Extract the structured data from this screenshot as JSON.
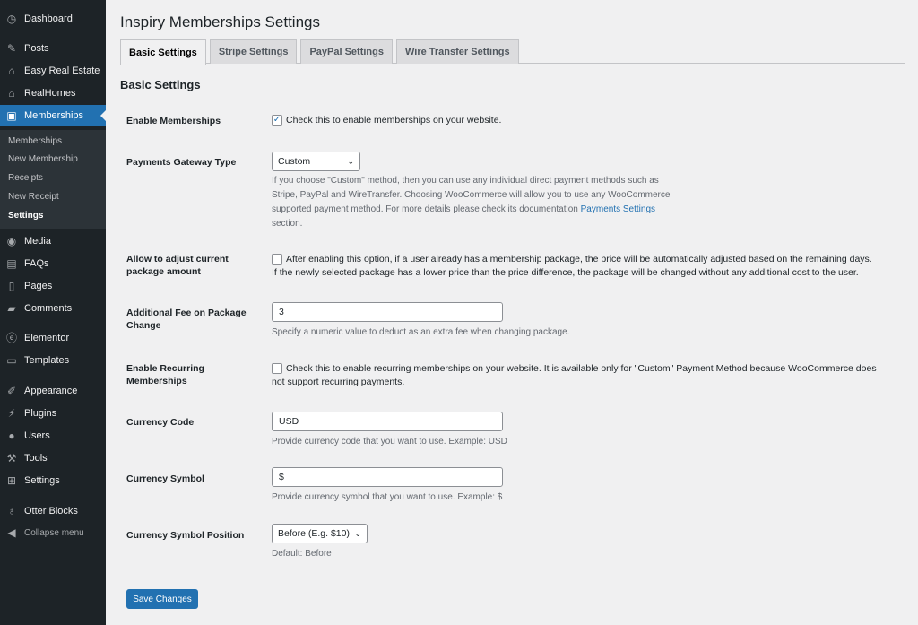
{
  "sidebar": {
    "items": [
      {
        "label": "Dashboard",
        "icon": "dashboard-icon"
      },
      {
        "label": "Posts",
        "icon": "pin-icon"
      },
      {
        "label": "Easy Real Estate",
        "icon": "house-icon"
      },
      {
        "label": "RealHomes",
        "icon": "house-icon"
      },
      {
        "label": "Memberships",
        "icon": "id-card-icon"
      },
      {
        "label": "Media",
        "icon": "media-icon"
      },
      {
        "label": "FAQs",
        "icon": "chat-icon"
      },
      {
        "label": "Pages",
        "icon": "page-icon"
      },
      {
        "label": "Comments",
        "icon": "comment-icon"
      },
      {
        "label": "Elementor",
        "icon": "elementor-icon"
      },
      {
        "label": "Templates",
        "icon": "folder-icon"
      },
      {
        "label": "Appearance",
        "icon": "brush-icon"
      },
      {
        "label": "Plugins",
        "icon": "plug-icon"
      },
      {
        "label": "Users",
        "icon": "user-icon"
      },
      {
        "label": "Tools",
        "icon": "wrench-icon"
      },
      {
        "label": "Settings",
        "icon": "settings-icon"
      },
      {
        "label": "Otter Blocks",
        "icon": "otter-icon"
      }
    ],
    "submenu": [
      "Memberships",
      "New Membership",
      "Receipts",
      "New Receipt",
      "Settings"
    ],
    "collapse": "Collapse menu"
  },
  "page": {
    "title": "Inspiry Memberships Settings",
    "tabs": [
      "Basic Settings",
      "Stripe Settings",
      "PayPal Settings",
      "Wire Transfer Settings"
    ],
    "section_title": "Basic Settings"
  },
  "fields": {
    "enable": {
      "label": "Enable Memberships",
      "checked": true,
      "text": "Check this to enable memberships on your website."
    },
    "gateway": {
      "label": "Payments Gateway Type",
      "value": "Custom",
      "desc_1": "If you choose \"Custom\" method, then you can use any individual direct payment methods such as",
      "desc_2": "Stripe, PayPal and WireTransfer. Choosing WooCommerce will allow you to use any WooCommerce",
      "desc_3": "supported payment method. For more details please check its documentation",
      "desc_link": "Payments Settings",
      "desc_4": "section."
    },
    "adjust": {
      "label_1": "Allow to adjust current",
      "label_2": "package amount",
      "checked": false,
      "text_1": "After enabling this option, if a user already has a membership package, the price will be automatically adjusted based on the remaining days.",
      "text_2": "If the newly selected package has a lower price than the price difference, the package will be changed without any additional cost to the user."
    },
    "fee": {
      "label_1": "Additional Fee on Package",
      "label_2": "Change",
      "value": "3",
      "desc": "Specify a numeric value to deduct as an extra fee when changing package."
    },
    "recurring": {
      "label_1": "Enable Recurring",
      "label_2": "Memberships",
      "checked": false,
      "text_1": "Check this to enable recurring memberships on your website. It is available only for \"Custom\" Payment Method because WooCommerce does",
      "text_2": "not support recurring payments."
    },
    "currency_code": {
      "label": "Currency Code",
      "value": "USD",
      "desc": "Provide currency code that you want to use. Example: USD"
    },
    "currency_symbol": {
      "label": "Currency Symbol",
      "value": "$",
      "desc": "Provide currency symbol that you want to use. Example: $"
    },
    "symbol_position": {
      "label": "Currency Symbol Position",
      "value": "Before (E.g. $10)",
      "desc": "Default: Before"
    }
  },
  "save_label": "Save Changes",
  "colors": {
    "sidebar_bg": "#1d2327",
    "accent": "#2271b1",
    "page_bg": "#f0f0f1"
  }
}
